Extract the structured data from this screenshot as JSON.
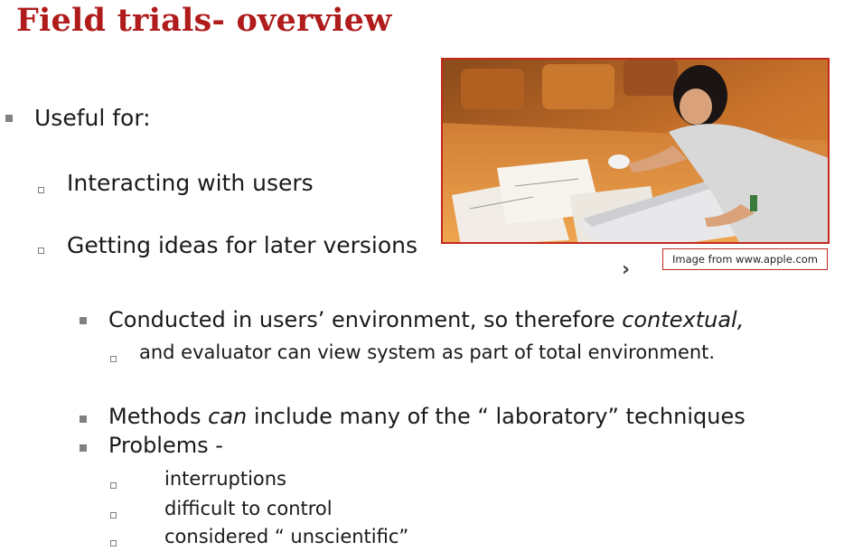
{
  "slide": {
    "title": "Field trials- overview",
    "useful_for": "Useful for:",
    "sub1": "Interacting with users",
    "sub2": "Getting ideas for later versions",
    "conducted_a": "Conducted in users’ environment, so therefore ",
    "conducted_b": "contextual,",
    "evaluator": "and evaluator can view system as part of total environment.",
    "methods_a": "Methods ",
    "methods_b": "can",
    "methods_c": " include many of the “ laboratory”  techniques",
    "problems": "Problems -",
    "p1": "interruptions",
    "p2": "difficult to control",
    "p3": "considered “ unscientific”",
    "caption": "Image from www.apple.com",
    "chevron": "›"
  },
  "colors": {
    "title": "#b01c1c",
    "frame": "#c4291c",
    "bullet": "#808080"
  },
  "icons": {
    "chevron": "chevron-right-icon",
    "photo": "photo-woman-laptop"
  }
}
